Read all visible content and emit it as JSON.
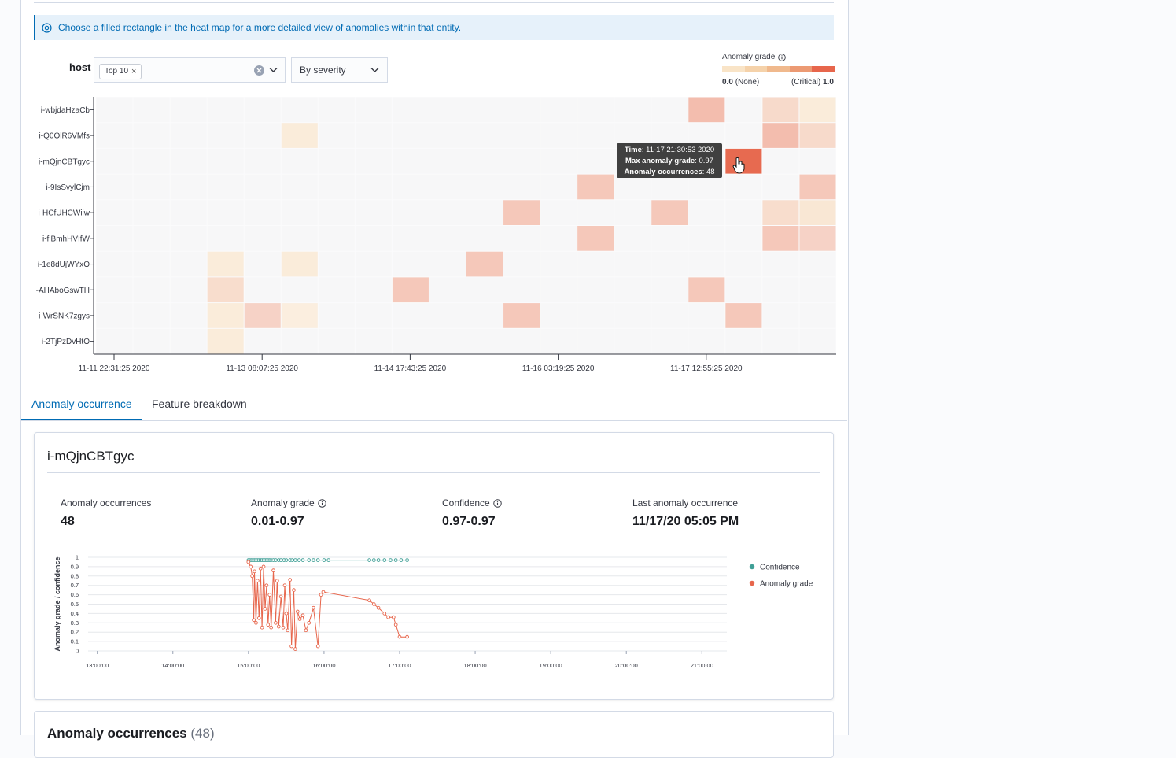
{
  "callout": {
    "text": "Choose a filled rectangle in the heat map for a more detailed view of anomalies within that entity."
  },
  "filters": {
    "host_label": "host",
    "selected_chip": "Top 10",
    "sort_select": "By severity"
  },
  "legend": {
    "title": "Anomaly grade",
    "min_label": "0.0",
    "min_suffix": "(None)",
    "max_prefix": "(Critical)",
    "max_label": "1.0",
    "colors": [
      "#f9e4c7",
      "#f5d2aa",
      "#f0b98d",
      "#ec9a73",
      "#e7664c"
    ]
  },
  "heatmap": {
    "hosts": [
      "i-wbjdaHzaCb",
      "i-Q0OlR6VMfs",
      "i-mQjnCBTgyc",
      "i-9IsSvylCjm",
      "i-HCfUHCWiiw",
      "i-fiBmhHVIfW",
      "i-1e8dUjWYxO",
      "i-AHAboGswTH",
      "i-WrSNK7zgys",
      "i-2TjPzDvHtO"
    ],
    "time_ticks": [
      "11-11 22:31:25 2020",
      "11-13 08:07:25 2020",
      "11-14 17:43:25 2020",
      "11-16 03:19:25 2020",
      "11-17 12:55:25 2020"
    ],
    "column_count": 20,
    "cells": [
      {
        "row": 0,
        "col": 16,
        "grade": 0.35
      },
      {
        "row": 0,
        "col": 18,
        "grade": 0.2
      },
      {
        "row": 0,
        "col": 19,
        "grade": 0.08
      },
      {
        "row": 1,
        "col": 5,
        "grade": 0.08
      },
      {
        "row": 1,
        "col": 18,
        "grade": 0.35
      },
      {
        "row": 1,
        "col": 19,
        "grade": 0.2
      },
      {
        "row": 2,
        "col": 17,
        "grade": 0.97
      },
      {
        "row": 3,
        "col": 13,
        "grade": 0.3
      },
      {
        "row": 3,
        "col": 19,
        "grade": 0.3
      },
      {
        "row": 4,
        "col": 11,
        "grade": 0.3
      },
      {
        "row": 4,
        "col": 15,
        "grade": 0.3
      },
      {
        "row": 4,
        "col": 18,
        "grade": 0.18
      },
      {
        "row": 4,
        "col": 19,
        "grade": 0.12
      },
      {
        "row": 5,
        "col": 13,
        "grade": 0.3
      },
      {
        "row": 5,
        "col": 18,
        "grade": 0.3
      },
      {
        "row": 5,
        "col": 19,
        "grade": 0.25
      },
      {
        "row": 6,
        "col": 3,
        "grade": 0.08
      },
      {
        "row": 6,
        "col": 5,
        "grade": 0.08
      },
      {
        "row": 6,
        "col": 10,
        "grade": 0.3
      },
      {
        "row": 7,
        "col": 3,
        "grade": 0.18
      },
      {
        "row": 7,
        "col": 8,
        "grade": 0.3
      },
      {
        "row": 7,
        "col": 16,
        "grade": 0.3
      },
      {
        "row": 8,
        "col": 3,
        "grade": 0.08
      },
      {
        "row": 8,
        "col": 4,
        "grade": 0.25
      },
      {
        "row": 8,
        "col": 5,
        "grade": 0.06
      },
      {
        "row": 8,
        "col": 11,
        "grade": 0.3
      },
      {
        "row": 8,
        "col": 17,
        "grade": 0.3
      },
      {
        "row": 9,
        "col": 3,
        "grade": 0.08
      }
    ],
    "tooltip": {
      "time_label": "Time",
      "time_value": "11-17 21:30:53 2020",
      "grade_label": "Max anomaly grade",
      "grade_value": "0.97",
      "occ_label": "Anomaly occurrences",
      "occ_value": "48"
    }
  },
  "tabs": [
    {
      "label": "Anomaly occurrence",
      "active": true
    },
    {
      "label": "Feature breakdown",
      "active": false
    }
  ],
  "entity": {
    "title": "i-mQjnCBTgyc",
    "stats": [
      {
        "label": "Anomaly occurrences",
        "value": "48",
        "info": false
      },
      {
        "label": "Anomaly grade",
        "value": "0.01-0.97",
        "info": true
      },
      {
        "label": "Confidence",
        "value": "0.97-0.97",
        "info": true
      },
      {
        "label": "Last anomaly occurrence",
        "value": "11/17/20 05:05 PM",
        "info": false
      }
    ]
  },
  "chart_data": {
    "type": "line",
    "ylabel": "Anomaly grade / confidence",
    "xlabel": "",
    "ylim": [
      0,
      1
    ],
    "y_ticks": [
      "0",
      "0.1",
      "0.2",
      "0.3",
      "0.4",
      "0.5",
      "0.6",
      "0.7",
      "0.8",
      "0.9",
      "1"
    ],
    "x_ticks": [
      "13:00:00",
      "14:00:00",
      "15:00:00",
      "16:00:00",
      "17:00:00",
      "18:00:00",
      "19:00:00",
      "20:00:00",
      "21:00:00"
    ],
    "x_range_hours": [
      12.92,
      21.33
    ],
    "legend_position": "right",
    "series": [
      {
        "name": "Confidence",
        "color": "#3f9f96",
        "x": [
          15.0,
          15.02,
          15.04,
          15.06,
          15.08,
          15.1,
          15.12,
          15.14,
          15.16,
          15.18,
          15.2,
          15.22,
          15.24,
          15.26,
          15.28,
          15.3,
          15.33,
          15.36,
          15.4,
          15.43,
          15.47,
          15.5,
          15.55,
          15.58,
          15.62,
          15.67,
          15.72,
          15.8,
          15.86,
          15.92,
          16.0,
          16.06,
          16.6,
          16.66,
          16.72,
          16.8,
          16.88,
          16.95,
          17.02,
          17.1
        ],
        "values": [
          0.97,
          0.97,
          0.97,
          0.97,
          0.97,
          0.97,
          0.97,
          0.97,
          0.97,
          0.97,
          0.97,
          0.97,
          0.97,
          0.97,
          0.97,
          0.97,
          0.97,
          0.97,
          0.97,
          0.97,
          0.97,
          0.97,
          0.97,
          0.97,
          0.97,
          0.97,
          0.97,
          0.97,
          0.97,
          0.97,
          0.97,
          0.97,
          0.97,
          0.97,
          0.97,
          0.97,
          0.97,
          0.97,
          0.97,
          0.97
        ]
      },
      {
        "name": "Anomaly grade",
        "color": "#e7664c",
        "x": [
          15.0,
          15.03,
          15.05,
          15.07,
          15.08,
          15.1,
          15.12,
          15.14,
          15.16,
          15.18,
          15.2,
          15.22,
          15.24,
          15.26,
          15.28,
          15.3,
          15.33,
          15.36,
          15.38,
          15.4,
          15.43,
          15.46,
          15.48,
          15.5,
          15.52,
          15.55,
          15.57,
          15.6,
          15.62,
          15.65,
          15.68,
          15.72,
          15.76,
          15.8,
          15.86,
          15.92,
          15.96,
          15.99,
          16.6,
          16.66,
          16.72,
          16.8,
          16.85,
          16.92,
          16.95,
          17.0,
          17.1
        ],
        "values": [
          0.95,
          0.9,
          0.8,
          0.33,
          0.85,
          0.3,
          0.75,
          0.35,
          0.88,
          0.25,
          0.9,
          0.45,
          0.7,
          0.28,
          0.6,
          0.25,
          0.86,
          0.3,
          0.75,
          0.26,
          0.58,
          0.25,
          0.7,
          0.4,
          0.22,
          0.76,
          0.05,
          0.65,
          0.02,
          0.42,
          0.34,
          0.38,
          0.22,
          0.3,
          0.46,
          0.05,
          0.6,
          0.63,
          0.54,
          0.5,
          0.46,
          0.4,
          0.36,
          0.36,
          0.28,
          0.15,
          0.15
        ]
      }
    ]
  },
  "occurrences_section": {
    "title": "Anomaly occurrences",
    "count": "(48)"
  }
}
